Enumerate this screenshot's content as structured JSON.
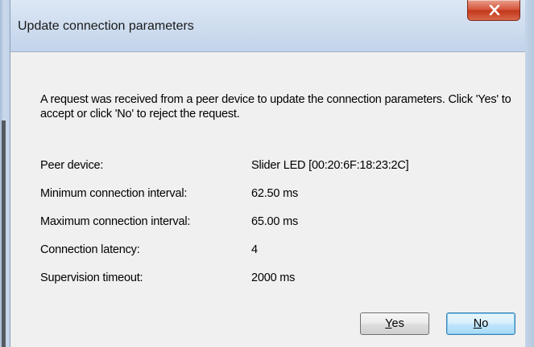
{
  "window": {
    "title": "Update connection parameters",
    "close_icon": "close-x-icon"
  },
  "message": "A request was received from a peer device to update the connection parameters. Click 'Yes' to accept or click 'No' to reject the request.",
  "fields": [
    {
      "label": "Peer device:",
      "value": "Slider LED [00:20:6F:18:23:2C]"
    },
    {
      "label": "Minimum connection interval:",
      "value": "62.50 ms"
    },
    {
      "label": "Maximum connection interval:",
      "value": "65.00 ms"
    },
    {
      "label": "Connection latency:",
      "value": "4"
    },
    {
      "label": "Supervision timeout:",
      "value": "2000 ms"
    }
  ],
  "buttons": {
    "yes_mnemonic": "Y",
    "yes_rest": "es",
    "no_mnemonic": "N",
    "no_rest": "o"
  },
  "colors": {
    "close_button": "#c2381d",
    "client_bg": "#f0f0f0"
  }
}
